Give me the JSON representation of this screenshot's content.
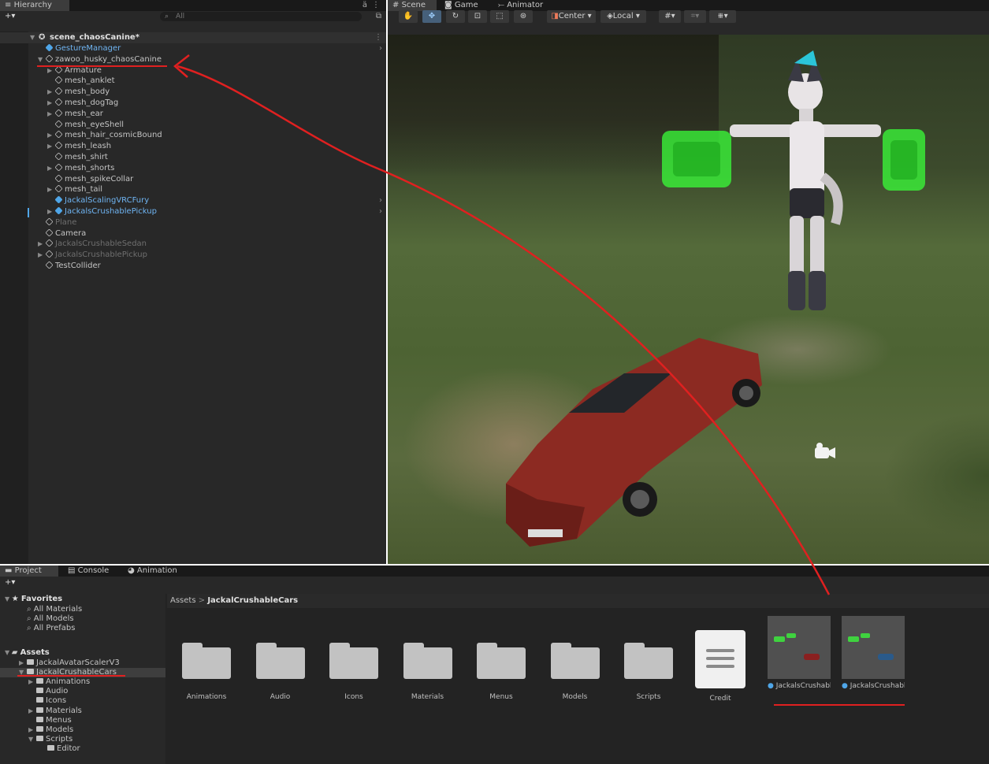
{
  "hierarchy": {
    "tab": "Hierarchy",
    "add": "+▾",
    "search_placeholder": "All",
    "scene_name": "scene_chaosCanine*",
    "items": [
      {
        "label": "GestureManager",
        "indent": 1,
        "style": "blue",
        "icon": "prefab",
        "fold": ""
      },
      {
        "label": "zawoo_husky_chaosCanine",
        "indent": 1,
        "style": "normal",
        "icon": "object",
        "fold": "▼"
      },
      {
        "label": "Armature",
        "indent": 2,
        "style": "normal",
        "icon": "object",
        "fold": "▶"
      },
      {
        "label": "mesh_anklet",
        "indent": 2,
        "style": "normal",
        "icon": "object",
        "fold": ""
      },
      {
        "label": "mesh_body",
        "indent": 2,
        "style": "normal",
        "icon": "object",
        "fold": "▶"
      },
      {
        "label": "mesh_dogTag",
        "indent": 2,
        "style": "normal",
        "icon": "object",
        "fold": "▶"
      },
      {
        "label": "mesh_ear",
        "indent": 2,
        "style": "normal",
        "icon": "object",
        "fold": "▶"
      },
      {
        "label": "mesh_eyeShell",
        "indent": 2,
        "style": "normal",
        "icon": "object",
        "fold": ""
      },
      {
        "label": "mesh_hair_cosmicBound",
        "indent": 2,
        "style": "normal",
        "icon": "object",
        "fold": "▶"
      },
      {
        "label": "mesh_leash",
        "indent": 2,
        "style": "normal",
        "icon": "object",
        "fold": "▶"
      },
      {
        "label": "mesh_shirt",
        "indent": 2,
        "style": "normal",
        "icon": "object",
        "fold": ""
      },
      {
        "label": "mesh_shorts",
        "indent": 2,
        "style": "normal",
        "icon": "object",
        "fold": "▶"
      },
      {
        "label": "mesh_spikeCollar",
        "indent": 2,
        "style": "normal",
        "icon": "object",
        "fold": ""
      },
      {
        "label": "mesh_tail",
        "indent": 2,
        "style": "normal",
        "icon": "object",
        "fold": "▶"
      },
      {
        "label": "JackalScalingVRCFury",
        "indent": 2,
        "style": "blue",
        "icon": "prefab",
        "fold": ""
      },
      {
        "label": "JackalsCrushablePickup",
        "indent": 2,
        "style": "blue",
        "icon": "prefab",
        "fold": "▶"
      },
      {
        "label": "Plane",
        "indent": 1,
        "style": "grey",
        "icon": "object",
        "fold": ""
      },
      {
        "label": "Camera",
        "indent": 1,
        "style": "normal",
        "icon": "object",
        "fold": ""
      },
      {
        "label": "JackalsCrushableSedan",
        "indent": 1,
        "style": "grey",
        "icon": "object",
        "fold": "▶"
      },
      {
        "label": "JackalsCrushablePickup",
        "indent": 1,
        "style": "grey",
        "icon": "object",
        "fold": "▶"
      },
      {
        "label": "TestCollider",
        "indent": 1,
        "style": "normal",
        "icon": "object",
        "fold": ""
      }
    ]
  },
  "scene": {
    "tabs": [
      "Scene",
      "Game",
      "Animator"
    ],
    "tool_icons": [
      "hand-icon",
      "move-icon",
      "rotate-icon",
      "scale-icon",
      "rect-icon",
      "transform-icon"
    ],
    "pivot": "Center ▾",
    "space": "Local ▾"
  },
  "project": {
    "tabs": [
      "Project",
      "Console",
      "Animation"
    ],
    "add": "+▾",
    "favorites_title": "Favorites",
    "favorites": [
      "All Materials",
      "All Models",
      "All Prefabs"
    ],
    "assets_title": "Assets",
    "tree": [
      {
        "label": "JackalAvatarScalerV3",
        "indent": 1,
        "fold": "▶",
        "open": false
      },
      {
        "label": "JackalCrushableCars",
        "indent": 1,
        "fold": "▼",
        "open": true,
        "selected": true
      },
      {
        "label": "Animations",
        "indent": 2,
        "fold": "▶",
        "open": false
      },
      {
        "label": "Audio",
        "indent": 2,
        "fold": "",
        "open": false
      },
      {
        "label": "Icons",
        "indent": 2,
        "fold": "",
        "open": false
      },
      {
        "label": "Materials",
        "indent": 2,
        "fold": "▶",
        "open": false
      },
      {
        "label": "Menus",
        "indent": 2,
        "fold": "",
        "open": false
      },
      {
        "label": "Models",
        "indent": 2,
        "fold": "▶",
        "open": false
      },
      {
        "label": "Scripts",
        "indent": 2,
        "fold": "▼",
        "open": true
      },
      {
        "label": "Editor",
        "indent": 3,
        "fold": "",
        "open": false
      }
    ],
    "breadcrumb_root": "Assets",
    "breadcrumb_sep": ">",
    "breadcrumb_current": "JackalCrushableCars",
    "folders": [
      "Animations",
      "Audio",
      "Icons",
      "Materials",
      "Menus",
      "Models",
      "Scripts"
    ],
    "credit_label": "Credit",
    "prefabs": [
      {
        "label": "JackalsCrushable...",
        "car_color": "#8a2020"
      },
      {
        "label": "JackalsCrushable...",
        "car_color": "#2a5a8a"
      }
    ]
  },
  "colors": {
    "accent_blue": "#6fb4f2",
    "annotation_red": "#e02020"
  }
}
